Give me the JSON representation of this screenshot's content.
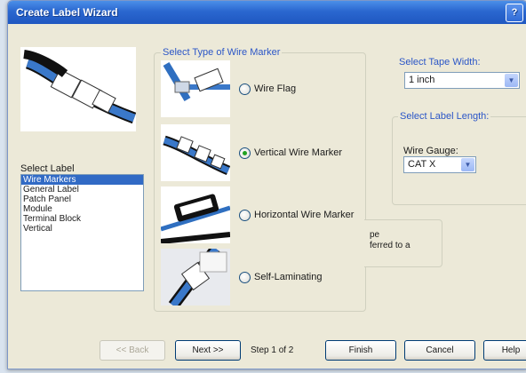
{
  "window": {
    "title": "Create Label Wizard",
    "title_button_glyph": "?"
  },
  "label_list": {
    "caption": "Select Label",
    "items": [
      "Wire Markers",
      "General Label",
      "Patch Panel",
      "Module",
      "Terminal Block",
      "Vertical"
    ],
    "selected_index": 0
  },
  "wire_marker_type": {
    "caption": "Select Type of Wire Marker",
    "options": [
      {
        "label": "Wire Flag",
        "checked": false
      },
      {
        "label": "Vertical Wire Marker",
        "checked": true
      },
      {
        "label": "Horizontal Wire Marker",
        "checked": false
      },
      {
        "label": "Self-Laminating",
        "checked": false
      }
    ]
  },
  "tape_width": {
    "caption": "Select Tape Width:",
    "value": "1 inch"
  },
  "label_length": {
    "caption": "Select Label Length:",
    "gauge_caption": "Wire Gauge:",
    "gauge_value": "CAT X"
  },
  "note": {
    "line1": "pe",
    "line2": "ferred to a"
  },
  "buttons": {
    "back": "<< Back",
    "next": "Next >>",
    "finish": "Finish",
    "cancel": "Cancel",
    "help": "Help"
  },
  "step_text": "Step 1 of 2",
  "colors": {
    "title_bar": "#2a67d0",
    "selection": "#316ac5",
    "group_caption": "#2b56c7",
    "radio_dot": "#21a121"
  }
}
